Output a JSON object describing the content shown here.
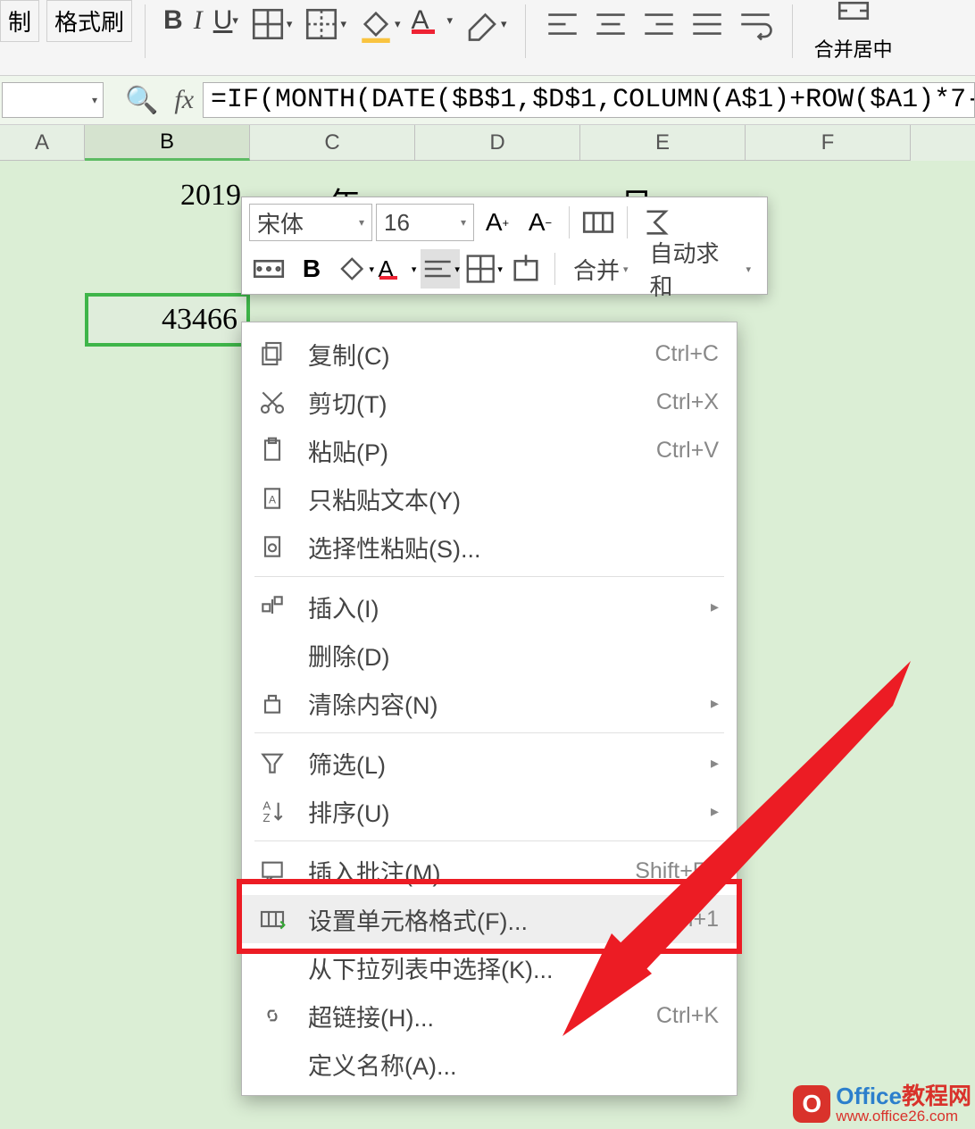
{
  "ribbon": {
    "copy_label": "制",
    "format_painter_label": "格式刷",
    "merge_center_label": "合并居中"
  },
  "formula_bar": {
    "fx_label": "fx",
    "formula": "=IF(MONTH(DATE($B$1,$D$1,COLUMN(A$1)+ROW($A1)*7-"
  },
  "columns": [
    "A",
    "B",
    "C",
    "D",
    "E",
    "F"
  ],
  "cells": {
    "b1": "2019",
    "c1_partial": "年",
    "e1_partial": "日",
    "selected": "43466"
  },
  "mini_toolbar": {
    "font": "宋体",
    "size": "16",
    "merge_label": "合并",
    "autosum_label": "自动求和"
  },
  "context_menu": {
    "copy": {
      "label": "复制(C)",
      "shortcut": "Ctrl+C"
    },
    "cut": {
      "label": "剪切(T)",
      "shortcut": "Ctrl+X"
    },
    "paste": {
      "label": "粘贴(P)",
      "shortcut": "Ctrl+V"
    },
    "paste_text": {
      "label": "只粘贴文本(Y)"
    },
    "paste_special": {
      "label": "选择性粘贴(S)..."
    },
    "insert": {
      "label": "插入(I)"
    },
    "delete": {
      "label": "删除(D)"
    },
    "clear": {
      "label": "清除内容(N)"
    },
    "filter": {
      "label": "筛选(L)"
    },
    "sort": {
      "label": "排序(U)"
    },
    "comment": {
      "label": "插入批注(M)...",
      "shortcut": "Shift+F2"
    },
    "format_cells": {
      "label": "设置单元格格式(F)...",
      "shortcut": "Ctrl+1"
    },
    "dropdown_pick": {
      "label": "从下拉列表中选择(K)..."
    },
    "hyperlink": {
      "label": "超链接(H)...",
      "shortcut": "Ctrl+K"
    },
    "define_name": {
      "label": "定义名称(A)..."
    }
  },
  "watermark": {
    "logo_letter": "O",
    "title_blue": "Office",
    "title_red": "教程网",
    "url": "www.office26.com"
  }
}
